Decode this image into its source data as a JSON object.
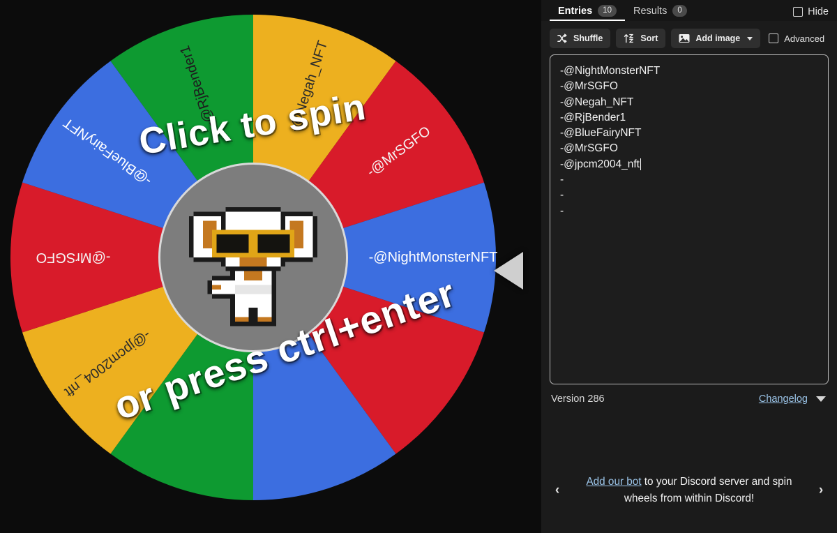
{
  "wheel": {
    "overlay_line1": "Click to spin",
    "overlay_line2": "or press ctrl+enter",
    "pointer_icon": "left-triangle-pointer",
    "hub_image_alt": "mascot-avatar",
    "segments": [
      {
        "label": "-@RjBender1",
        "color": "#0E9A31",
        "text_color": "#1d1d1d"
      },
      {
        "label": "-@Negah_NFT",
        "color": "#EDB01F",
        "text_color": "#2b2b2b"
      },
      {
        "label": "-@MrSGFO",
        "color": "#D81B2A",
        "text_color": "#f5f5f5"
      },
      {
        "label": "-@NightMonsterNFT",
        "color": "#3C6EE0",
        "text_color": "#ffffff"
      },
      {
        "label": "",
        "color": "#D81B2A",
        "text_color": "#f5f5f5"
      },
      {
        "label": "",
        "color": "#3C6EE0",
        "text_color": "#ffffff"
      },
      {
        "label": "",
        "color": "#0E9A31",
        "text_color": "#1d1d1d"
      },
      {
        "label": "-@jpcm2004_nft",
        "color": "#EDB01F",
        "text_color": "#2b2b2b"
      },
      {
        "label": "-@MrSGFO",
        "color": "#D81B2A",
        "text_color": "#f5f5f5"
      },
      {
        "label": "-@BlueFairyNFT",
        "color": "#3C6EE0",
        "text_color": "#ffffff"
      }
    ]
  },
  "panel": {
    "tabs": [
      {
        "label": "Entries",
        "count": "10",
        "active": true
      },
      {
        "label": "Results",
        "count": "0",
        "active": false
      }
    ],
    "hide_label": "Hide",
    "toolbar": {
      "shuffle_label": "Shuffle",
      "sort_label": "Sort",
      "add_image_label": "Add image",
      "advanced_label": "Advanced"
    },
    "entries": [
      "-@NightMonsterNFT",
      "-@MrSGFO",
      "-@Negah_NFT",
      "-@RjBender1",
      "-@BlueFairyNFT",
      "-@MrSGFO",
      "-@jpcm2004_nft",
      "-",
      "-",
      "-"
    ],
    "caret_after_entry_index": 6,
    "version_label": "Version 286",
    "changelog_label": "Changelog",
    "promo": {
      "link_text": "Add our bot",
      "rest_text": " to your Discord server and spin wheels from within Discord!",
      "prev_icon": "chevron-left-icon",
      "next_icon": "chevron-right-icon"
    }
  }
}
